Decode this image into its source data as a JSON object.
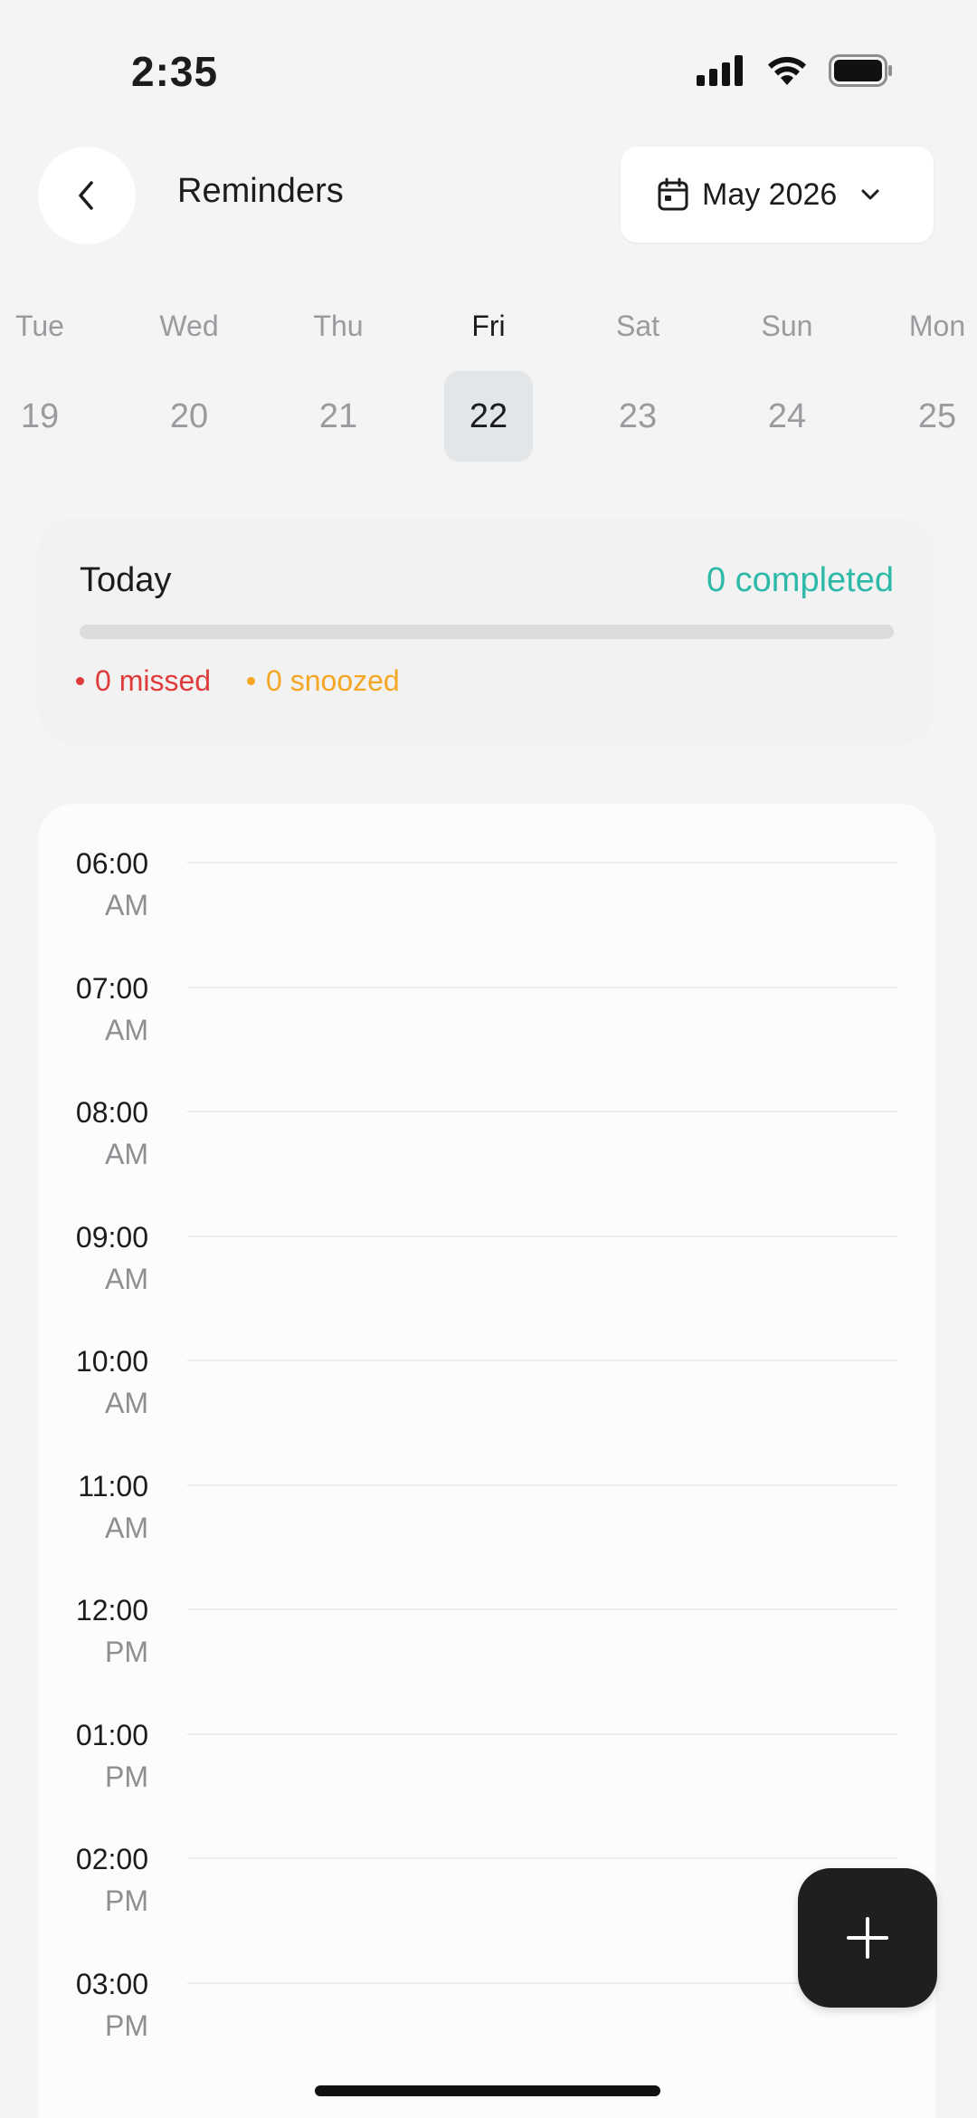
{
  "status_bar": {
    "time": "2:35"
  },
  "header": {
    "title": "Reminders",
    "month_label": "May 2026",
    "icons": {
      "back": "chevron-left-icon",
      "calendar": "calendar-icon",
      "dropdown": "chevron-down-icon"
    }
  },
  "week": {
    "days": [
      {
        "name": "Tue",
        "num": "19"
      },
      {
        "name": "Wed",
        "num": "20"
      },
      {
        "name": "Thu",
        "num": "21"
      },
      {
        "name": "Fri",
        "num": "22"
      },
      {
        "name": "Sat",
        "num": "23"
      },
      {
        "name": "Sun",
        "num": "24"
      },
      {
        "name": "Mon",
        "num": "25"
      }
    ],
    "selected_index": 3
  },
  "summary": {
    "title": "Today",
    "completed": "0 completed",
    "progress": 0,
    "missed": "0 missed",
    "snoozed": "0 snoozed"
  },
  "timeline": {
    "hours": [
      {
        "time": "06:00",
        "period": "AM"
      },
      {
        "time": "07:00",
        "period": "AM"
      },
      {
        "time": "08:00",
        "period": "AM"
      },
      {
        "time": "09:00",
        "period": "AM"
      },
      {
        "time": "10:00",
        "period": "AM"
      },
      {
        "time": "11:00",
        "period": "AM"
      },
      {
        "time": "12:00",
        "period": "PM"
      },
      {
        "time": "01:00",
        "period": "PM"
      },
      {
        "time": "02:00",
        "period": "PM"
      },
      {
        "time": "03:00",
        "period": "PM"
      }
    ]
  },
  "colors": {
    "accent": "#2cb9a8",
    "missed": "#e03b3b",
    "snoozed": "#f5a623",
    "fab": "#1f1f1f"
  }
}
